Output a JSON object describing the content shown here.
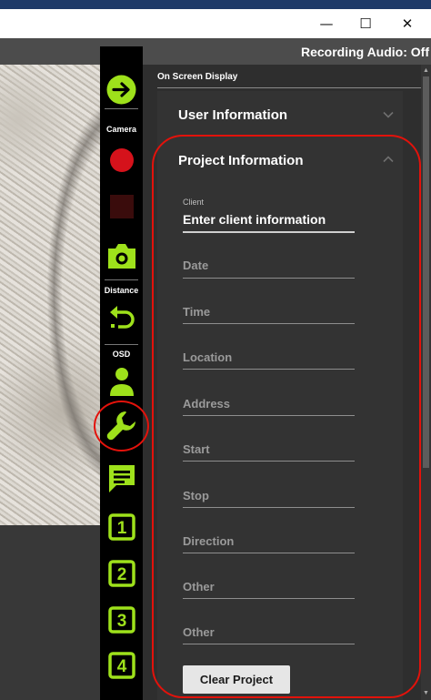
{
  "window": {
    "minimize_glyph": "—",
    "maximize_glyph": "☐",
    "close_glyph": "✕"
  },
  "status": {
    "text": "Recording Audio: Off"
  },
  "toolbar": {
    "camera_label": "Camera",
    "distance_label": "Distance",
    "osd_label": "OSD",
    "preset_1": "1",
    "preset_2": "2",
    "preset_3": "3",
    "preset_4": "4",
    "icons": [
      "arrow-right-icon",
      "record-icon",
      "stop-icon",
      "camera-icon",
      "reset-distance-icon",
      "person-icon",
      "wrench-icon",
      "comment-icon"
    ],
    "accent": "#9ee11b",
    "record_color": "#d5121b",
    "stop_color": "#3a0c0c"
  },
  "panel": {
    "title": "On Screen Display",
    "user_section": {
      "label": "User Information"
    },
    "project_section": {
      "label": "Project Information",
      "client": {
        "label": "Client",
        "value": "Enter client information"
      },
      "fields": [
        {
          "placeholder": "Date"
        },
        {
          "placeholder": "Time"
        },
        {
          "placeholder": "Location"
        },
        {
          "placeholder": "Address"
        },
        {
          "placeholder": "Start"
        },
        {
          "placeholder": "Stop"
        },
        {
          "placeholder": "Direction"
        },
        {
          "placeholder": "Other"
        },
        {
          "placeholder": "Other"
        }
      ],
      "clear_button": "Clear Project"
    }
  },
  "highlight_color": "#e3120b"
}
